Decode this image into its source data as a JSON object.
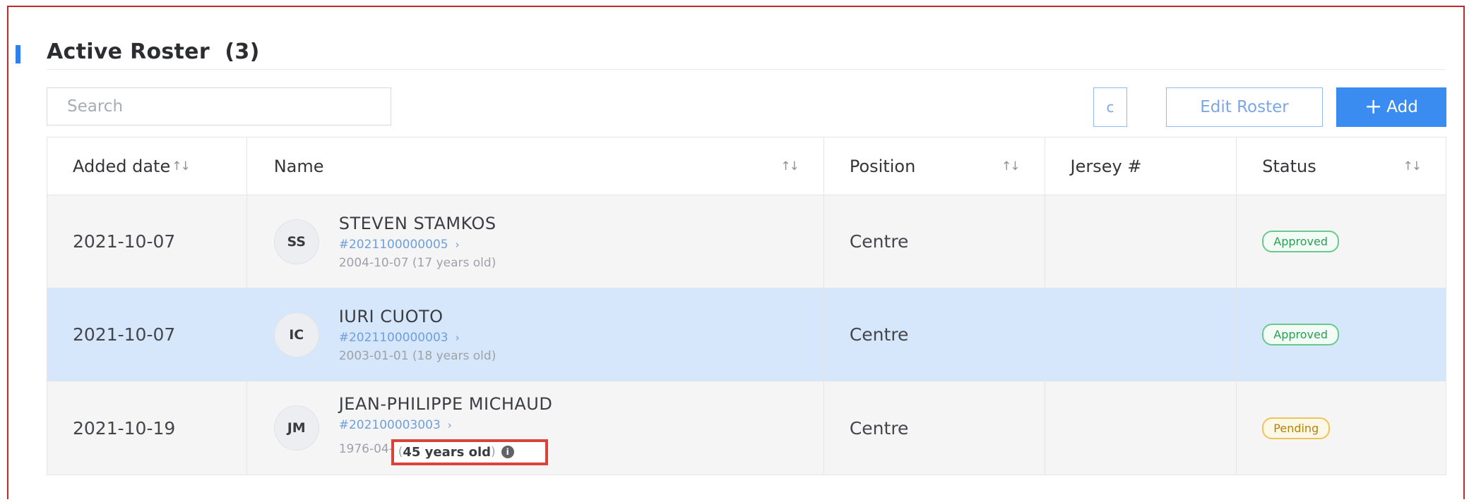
{
  "roster": {
    "title": "Active Roster",
    "count": "(3)",
    "search_placeholder": "Search",
    "refresh_symbol": "c",
    "edit_label": "Edit Roster",
    "add_plus": "+",
    "add_label": "Add"
  },
  "colors": {
    "accent": "#2f80ed",
    "primary_button": "#3b8cf1",
    "selected_row": "#d6e6fb",
    "approved": "#2e9d55",
    "pending": "#b08312",
    "highlight": "#d9433a"
  },
  "table": {
    "headers": {
      "added_date": "Added date",
      "name": "Name",
      "position": "Position",
      "jersey": "Jersey #",
      "status": "Status"
    },
    "sort_icon": "↑↓",
    "rows": [
      {
        "added_date": "2021-10-07",
        "initials": "SS",
        "name": "STEVEN STAMKOS",
        "id": "#2021100000005",
        "dob": "2004-10-07 (17 years old)",
        "position": "Centre",
        "jersey": "",
        "status": "Approved"
      },
      {
        "added_date": "2021-10-07",
        "initials": "IC",
        "name": "IURI CUOTO",
        "id": "#2021100000003",
        "dob": "2003-01-01 (18 years old)",
        "position": "Centre",
        "jersey": "",
        "status": "Approved"
      },
      {
        "added_date": "2021-10-19",
        "initials": "JM",
        "name": "JEAN-PHILIPPE MICHAUD",
        "id": "#202100003003",
        "dob_prefix": "1976-04-2",
        "age_open": "(",
        "age_text": "45 years old",
        "age_close": ")",
        "info_symbol": "i",
        "position": "Centre",
        "jersey": "",
        "status": "Pending"
      }
    ]
  }
}
